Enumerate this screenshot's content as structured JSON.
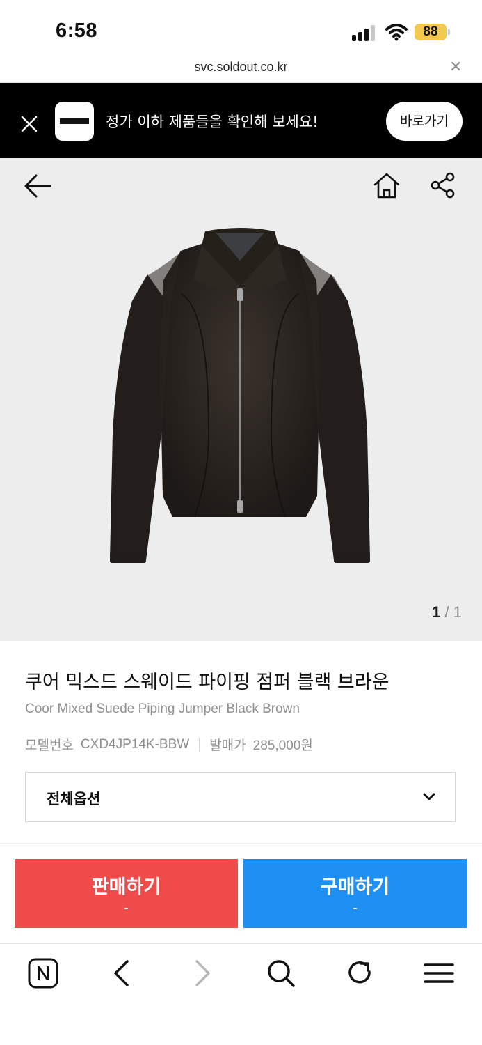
{
  "status_bar": {
    "time": "6:58",
    "battery": "88",
    "url": "svc.soldout.co.kr"
  },
  "banner": {
    "text": "정가 이하 제품들을 확인해 보세요!",
    "button_label": "바로가기"
  },
  "product": {
    "image_counter": {
      "current": "1",
      "separator": "/",
      "total": "1"
    },
    "title_ko": "쿠어 믹스드 스웨이드 파이핑 점퍼 블랙 브라운",
    "title_en": "Coor Mixed Suede Piping Jumper Black Brown",
    "model_label": "모델번호",
    "model_number": "CXD4JP14K-BBW",
    "release_price_label": "발매가",
    "release_price": "285,000원",
    "options_label": "전체옵션"
  },
  "actions": {
    "sell": {
      "label": "판매하기",
      "price": "-"
    },
    "buy": {
      "label": "구매하기",
      "price": "-"
    }
  },
  "colors": {
    "sell": "#ef4b4b",
    "buy": "#1e90f3",
    "banner_bg": "#000000",
    "battery": "#f2c94c"
  },
  "icons": {
    "header": [
      "back-arrow-icon",
      "home-icon",
      "share-icon"
    ],
    "browser_toolbar": [
      "naver-icon",
      "back-icon",
      "forward-icon",
      "search-icon",
      "refresh-icon",
      "menu-icon"
    ]
  }
}
